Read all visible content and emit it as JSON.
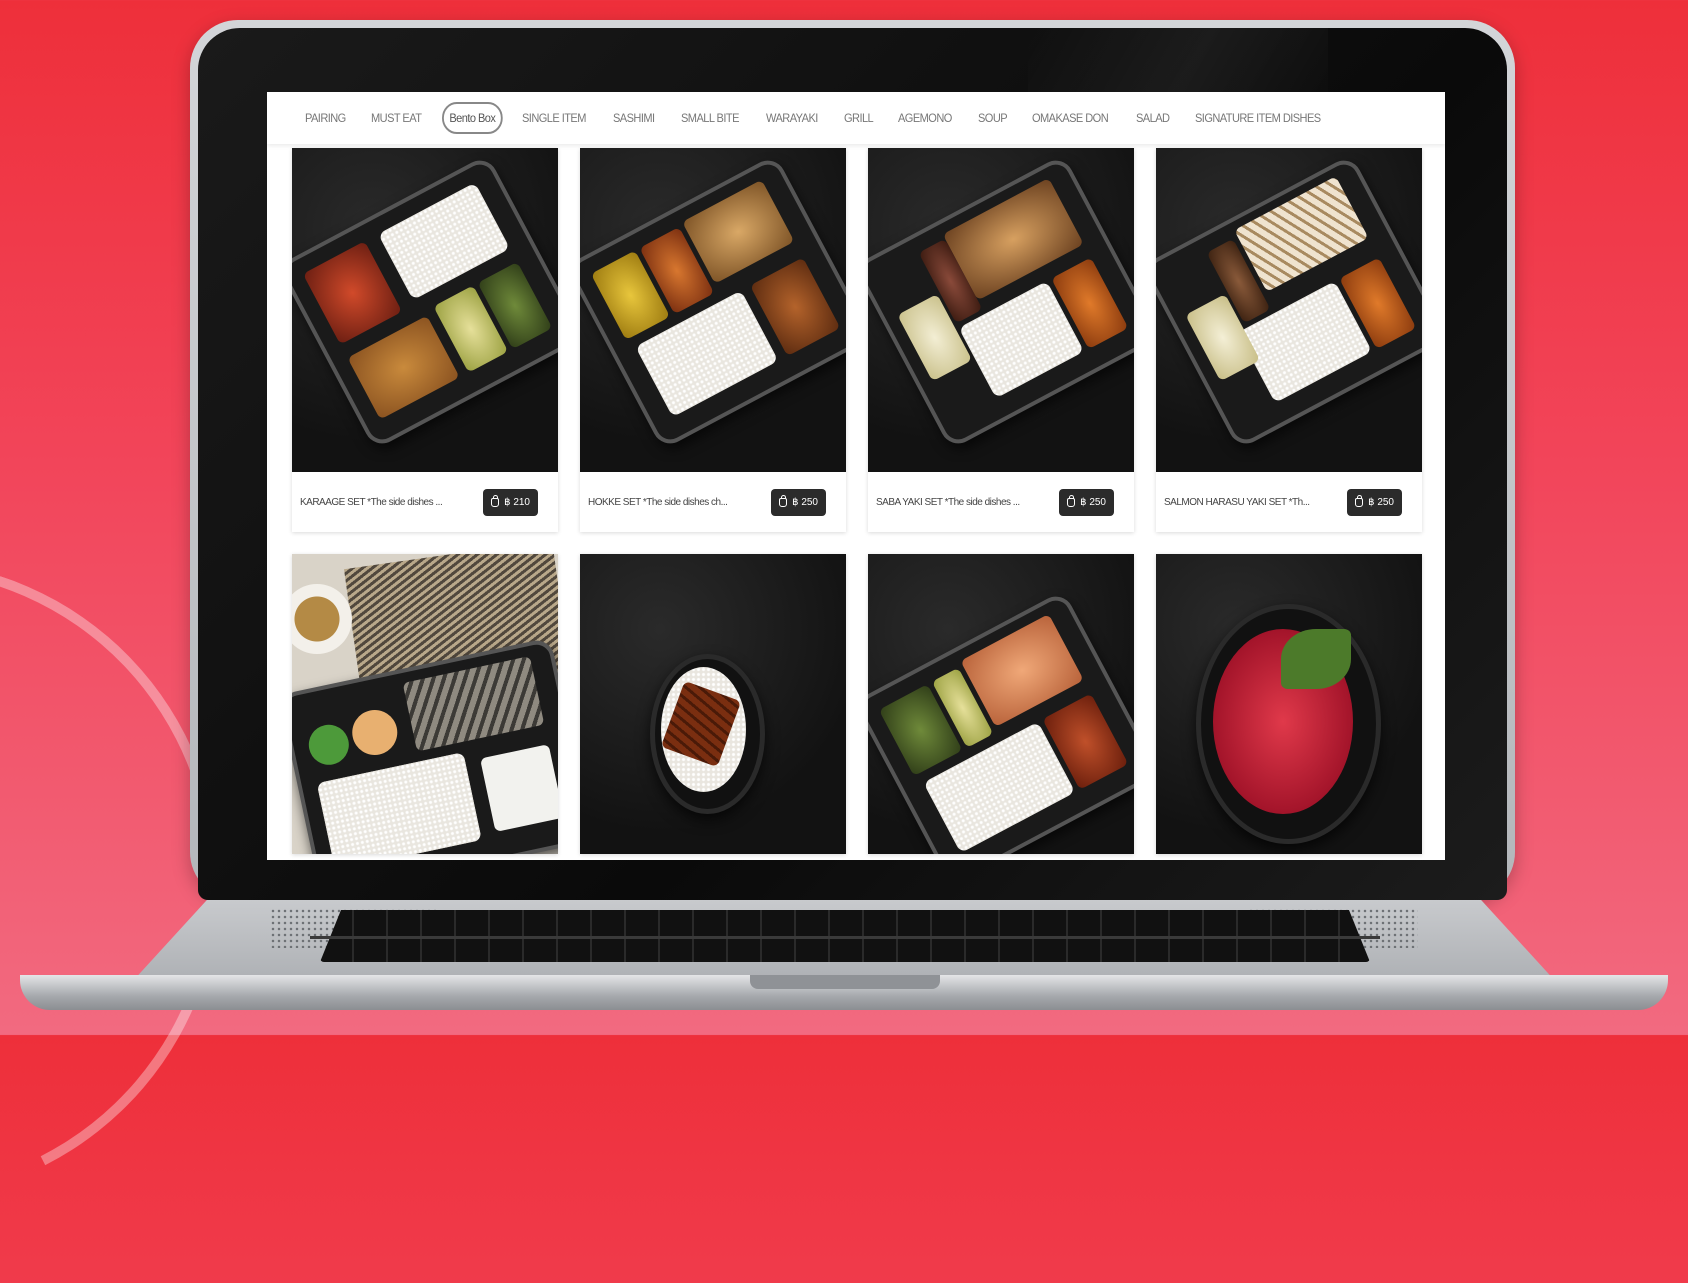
{
  "nav": {
    "items": [
      {
        "label": "PAIRING",
        "active": false
      },
      {
        "label": "MUST EAT",
        "active": false
      },
      {
        "label": "Bento Box",
        "active": true
      },
      {
        "label": "SINGLE ITEM",
        "active": false
      },
      {
        "label": "SASHIMI",
        "active": false
      },
      {
        "label": "SMALL BITE",
        "active": false
      },
      {
        "label": "WARAYAKI",
        "active": false
      },
      {
        "label": "GRILL",
        "active": false
      },
      {
        "label": "AGEMONO",
        "active": false
      },
      {
        "label": "SOUP",
        "active": false
      },
      {
        "label": "OMAKASE DON",
        "active": false
      },
      {
        "label": "SALAD",
        "active": false
      },
      {
        "label": "SIGNATURE ITEM DISHES",
        "active": false
      }
    ]
  },
  "products": [
    {
      "name": "KARAAGE SET *The side dishes ...",
      "price": "฿ 210",
      "image": "karaage-bento"
    },
    {
      "name": "HOKKE SET *The side dishes ch...",
      "price": "฿ 250",
      "image": "hokke-bento"
    },
    {
      "name": "SABA YAKI SET *The side dishes ...",
      "price": "฿ 250",
      "image": "saba-bento"
    },
    {
      "name": "SALMON HARASU YAKI SET *Th...",
      "price": "฿ 250",
      "image": "salmon-bento"
    },
    {
      "name": "",
      "price": "",
      "image": "saba-set-with-soup"
    },
    {
      "name": "",
      "price": "",
      "image": "unagi-don"
    },
    {
      "name": "",
      "price": "",
      "image": "salmon-bento-2"
    },
    {
      "name": "",
      "price": "",
      "image": "maguro-don"
    }
  ]
}
